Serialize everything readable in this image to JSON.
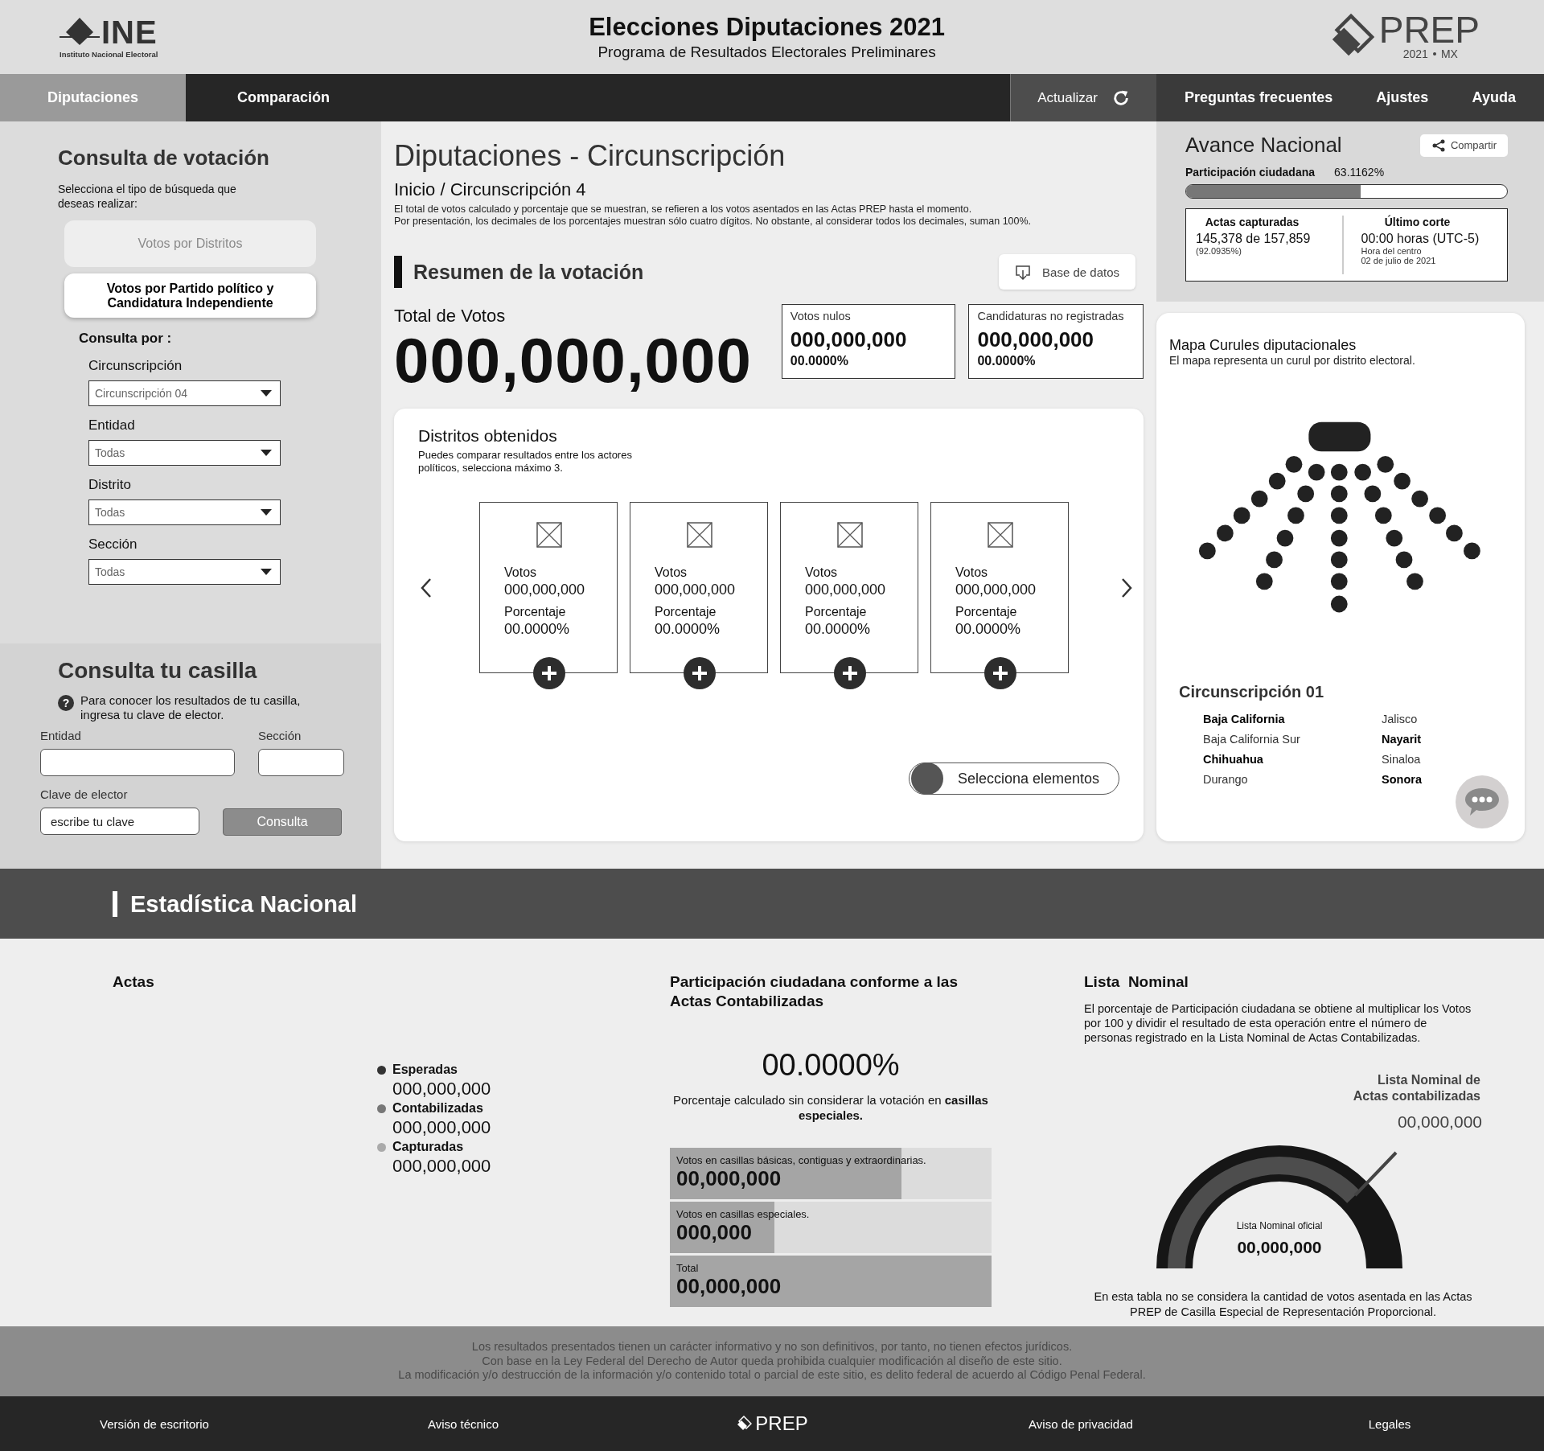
{
  "header": {
    "title": "Elecciones Diputaciones 2021",
    "subtitle": "Programa de Resultados Electorales Preliminares",
    "ine_logo": {
      "acronym": "INE",
      "name": "Instituto Nacional Electoral"
    },
    "prep_logo": {
      "name": "PREP",
      "year": "2021",
      "country": "MX"
    }
  },
  "nav": {
    "tabs": [
      {
        "label": "Diputaciones",
        "selected": true
      },
      {
        "label": "Comparación",
        "selected": false
      }
    ],
    "refresh": "Actualizar",
    "links": [
      "Preguntas frecuentes",
      "Ajustes",
      "Ayuda"
    ]
  },
  "consulta": {
    "title": "Consulta de votación",
    "hint": "Selecciona el tipo de búsqueda que deseas realizar:",
    "modes": [
      {
        "label": "Votos por Distritos",
        "selected": false
      },
      {
        "label": "Votos por Partido político y Candidatura Independiente",
        "selected": true
      }
    ],
    "consulta_por": "Consulta por :",
    "filters": [
      {
        "label": "Circunscripción",
        "value": "Circunscripción 04"
      },
      {
        "label": "Entidad",
        "value": "Todas"
      },
      {
        "label": "Distrito",
        "value": "Todas"
      },
      {
        "label": "Sección",
        "value": "Todas"
      }
    ]
  },
  "casilla": {
    "title": "Consulta tu casilla",
    "help_icon": "?",
    "help": "Para conocer los resultados de tu casilla, ingresa tu clave de elector.",
    "entidad_label": "Entidad",
    "seccion_label": "Sección",
    "clave_label": "Clave de elector",
    "clave_placeholder": "escribe tu clave",
    "button": "Consulta"
  },
  "resultados": {
    "title": "Diputaciones - Circunscripción",
    "breadcrumb": {
      "root": "Inicio",
      "separator": "/",
      "current": "Circunscripción 4"
    },
    "notes": [
      "El total de votos calculado y porcentaje que se muestran, se refieren a los votos asentados en las Actas PREP hasta el momento.",
      "Por presentación, los decimales de los porcentajes muestran sólo cuatro dígitos. No obstante, al considerar todos los decimales, suman 100%."
    ],
    "summary_title": "Resumen de la votación",
    "download": "Base de datos",
    "total_label": "Total de Votos",
    "total": "000,000,000",
    "boxes": [
      {
        "label": "Votos nulos",
        "value": "000,000,000",
        "percent": "00.0000%"
      },
      {
        "label": "Candidaturas no registradas",
        "value": "000,000,000",
        "percent": "00.0000%"
      }
    ],
    "distritos": {
      "title": "Distritos obtenidos",
      "hint": "Puedes comparar resultados entre los actores políticos, selecciona máximo 3.",
      "cards": [
        {
          "votes_label": "Votos",
          "votes": "000,000,000",
          "percent_label": "Porcentaje",
          "percent": "00.0000%"
        },
        {
          "votes_label": "Votos",
          "votes": "000,000,000",
          "percent_label": "Porcentaje",
          "percent": "00.0000%"
        },
        {
          "votes_label": "Votos",
          "votes": "000,000,000",
          "percent_label": "Porcentaje",
          "percent": "00.0000%"
        },
        {
          "votes_label": "Votos",
          "votes": "000,000,000",
          "percent_label": "Porcentaje",
          "percent": "00.0000%"
        }
      ],
      "toggle": {
        "label": "Selecciona elementos",
        "on": false
      }
    }
  },
  "avance": {
    "title": "Avance Nacional",
    "share": "Compartir",
    "participacion_label": "Participación ciudadana",
    "participacion": "63.1162%",
    "level": 0.545,
    "actas_label": "Actas capturadas",
    "actas": "145,378 de 157,859",
    "actas_pct": "(92.0935%)",
    "corte_label": "Último corte",
    "corte": "00:00 horas (UTC-5)",
    "corte_zone": "Hora del centro",
    "corte_date": "02 de julio de 2021"
  },
  "mapa": {
    "title": "Mapa Curules diputacionales",
    "subtitle": "El mapa representa un curul por distrito electoral.",
    "circunscripcion": "Circunscripción 01",
    "states": [
      {
        "name": "Baja California",
        "selected": true
      },
      {
        "name": "Baja California Sur",
        "selected": false
      },
      {
        "name": "Chihuahua",
        "selected": true
      },
      {
        "name": "Durango",
        "selected": false
      },
      {
        "name": "Jalisco",
        "selected": false
      },
      {
        "name": "Nayarit",
        "selected": true
      },
      {
        "name": "Sinaloa",
        "selected": false
      },
      {
        "name": "Sonora",
        "selected": true
      }
    ]
  },
  "estadistica": {
    "title": "Estadística Nacional",
    "actas": {
      "title": "Actas",
      "legend": [
        {
          "label": "Esperadas",
          "value": "000,000,000",
          "color": "#333333"
        },
        {
          "label": "Contabilizadas",
          "value": "000,000,000",
          "color": "#777777"
        },
        {
          "label": "Capturadas",
          "value": "000,000,000",
          "color": "#aaaaaa"
        }
      ]
    },
    "participacion": {
      "title": "Participación ciudadana conforme a las Actas Contabilizadas",
      "value": "00.0000%",
      "note": "Porcentaje calculado sin considerar la votación en **casillas especiales.**",
      "bars": [
        {
          "label": "Votos en casillas básicas, contiguas y extraordinarias.",
          "value": "00,000,000",
          "level": 0.72
        },
        {
          "label": "Votos en casillas especiales.",
          "value": "000,000",
          "level": 0.325
        },
        {
          "label": "Total",
          "value": "00,000,000",
          "level": 1
        }
      ]
    },
    "lista": {
      "title": "Lista  Nominal",
      "text": "El porcentaje de Participación ciudadana se obtiene al multiplicar los Votos por 100 y dividir el resultado de esta operación entre el número de personas registrado en la Lista Nominal de Actas Contabilizadas.",
      "gauge_label": "Lista Nominal de Actas contabilizadas",
      "gauge_value": "00,000,000",
      "oficial_label": "Lista Nominal oficial",
      "oficial_value": "00,000,000",
      "note": "En esta tabla no se considera la cantidad de votos asentada en las Actas PREP de Casilla Especial de Representación Proporcional."
    }
  },
  "footer": {
    "disclaimer": [
      "Los resultados presentados tienen un carácter informativo y no son definitivos, por tanto, no tienen efectos jurídicos.",
      "Con base en la Ley Federal del Derecho de Autor queda prohibida cualquier modificación al diseño de este sitio.",
      "La modificación y/o destrucción de la información y/o contenido total o parcial de este sitio, es delito federal de acuerdo al Código Penal Federal."
    ],
    "items": [
      {
        "kind": "link",
        "label": "Versión de escritorio"
      },
      {
        "kind": "link",
        "label": "Aviso técnico"
      },
      {
        "kind": "logo",
        "label": "PREP"
      },
      {
        "kind": "link",
        "label": "Aviso de privacidad"
      },
      {
        "kind": "link",
        "label": "Legales"
      }
    ]
  }
}
